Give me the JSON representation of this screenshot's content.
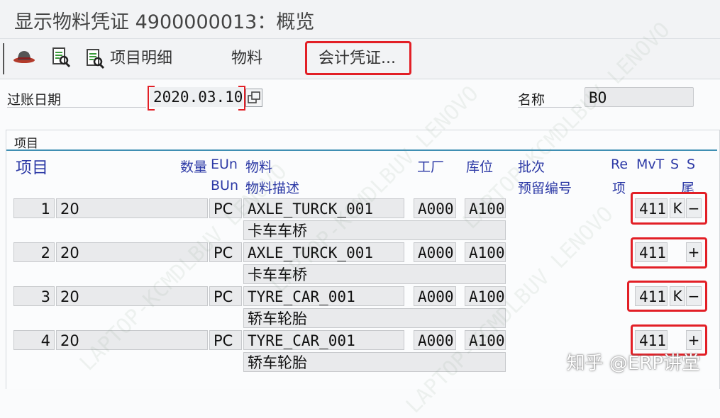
{
  "title": "显示物料凭证 4900000013：概览",
  "toolbar": {
    "items_detail": "项目明细",
    "material": "物料",
    "accounting_doc": "会计凭证..."
  },
  "header": {
    "posting_date_label": "过账日期",
    "posting_date": "2020.03.10",
    "name_label": "名称",
    "name_value": "BO"
  },
  "items_panel": {
    "title": "项目",
    "columns": {
      "item": "项目",
      "qty": "数量",
      "eun": "EUn",
      "bun": "BUn",
      "material": "物料",
      "material_desc": "物料描述",
      "plant": "工厂",
      "storage": "库位",
      "batch": "批次",
      "reservation": "预留编号",
      "re": "Re",
      "re_item": "项",
      "mvt": "MvT",
      "s1": "S",
      "s2": "S",
      "s2_sub": "尾"
    },
    "rows": [
      {
        "item": "1",
        "qty": "20",
        "unit": "PC",
        "material": "AXLE_TURCK_001",
        "desc": "卡车车桥",
        "plant": "A000",
        "storage": "A100",
        "mvt": "411",
        "s1": "K",
        "s2": "−"
      },
      {
        "item": "2",
        "qty": "20",
        "unit": "PC",
        "material": "AXLE_TURCK_001",
        "desc": "卡车车桥",
        "plant": "A000",
        "storage": "A100",
        "mvt": "411",
        "s1": "",
        "s2": "+"
      },
      {
        "item": "3",
        "qty": "20",
        "unit": "PC",
        "material": "TYRE_CAR_001",
        "desc": "轿车轮胎",
        "plant": "A000",
        "storage": "A100",
        "mvt": "411",
        "s1": "K",
        "s2": "−"
      },
      {
        "item": "4",
        "qty": "20",
        "unit": "PC",
        "material": "TYRE_CAR_001",
        "desc": "轿车轮胎",
        "plant": "A000",
        "storage": "A100",
        "mvt": "411",
        "s1": "",
        "s2": "+"
      }
    ]
  },
  "watermark": {
    "brand": "知乎 @ERP讲堂",
    "repeat": "LAPTOP-KCMDLBUV LENOVO"
  },
  "colors": {
    "header_blue": "#2d3aa6",
    "highlight_red": "#e21f26",
    "accent_teal": "#3f8fb3"
  }
}
